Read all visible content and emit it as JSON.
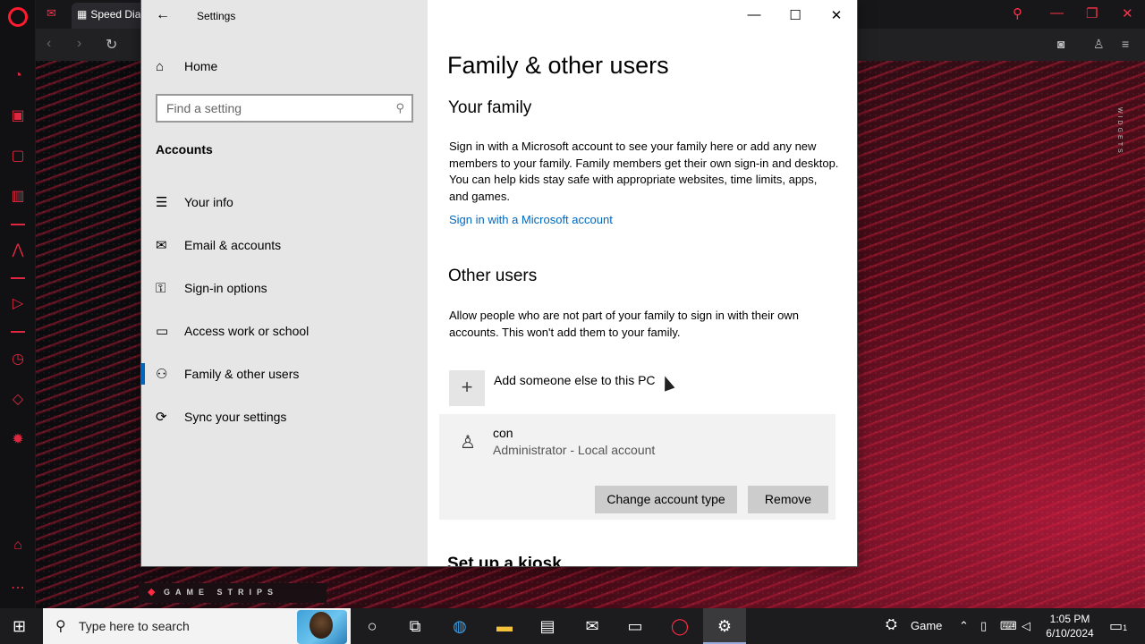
{
  "browser": {
    "tab_title": "Speed Dial",
    "widgets_label": "WIDGETS",
    "gamestrips_label": "GAME STRIPS",
    "accent": "#ff1b2d"
  },
  "settings": {
    "window_title": "Settings",
    "home_label": "Home",
    "search_placeholder": "Find a setting",
    "section": "Accounts",
    "nav": [
      {
        "label": "Your info",
        "icon": "contact-card-icon"
      },
      {
        "label": "Email & accounts",
        "icon": "mail-icon"
      },
      {
        "label": "Sign-in options",
        "icon": "key-icon"
      },
      {
        "label": "Access work or school",
        "icon": "briefcase-icon"
      },
      {
        "label": "Family & other users",
        "icon": "people-icon"
      },
      {
        "label": "Sync your settings",
        "icon": "sync-icon"
      }
    ],
    "selected_index": 4,
    "page_title": "Family & other users",
    "family": {
      "heading": "Your family",
      "body": "Sign in with a Microsoft account to see your family here or add any new members to your family. Family members get their own sign-in and desktop. You can help kids stay safe with appropriate websites, time limits, apps, and games.",
      "link": "Sign in with a Microsoft account"
    },
    "other_users": {
      "heading": "Other users",
      "body": "Allow people who are not part of your family to sign in with their own accounts. This won't add them to your family.",
      "add_label": "Add someone else to this PC",
      "user_name": "con",
      "user_desc": "Administrator - Local account",
      "change_button": "Change account type",
      "remove_button": "Remove"
    },
    "kiosk_heading": "Set up a kiosk",
    "link_color": "#0067c0"
  },
  "taskbar": {
    "search_placeholder": "Type here to search",
    "weather_label": "Game",
    "time": "1:05 PM",
    "date": "6/10/2024",
    "notification_count": "1"
  }
}
